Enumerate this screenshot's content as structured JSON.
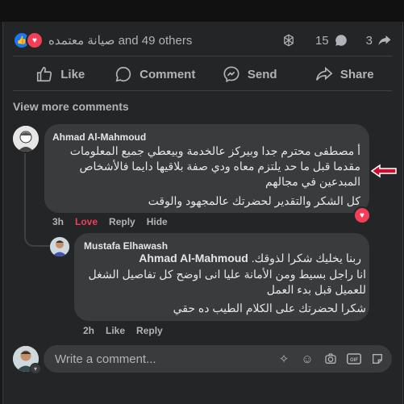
{
  "post": {
    "reaction_summary": "صيانة معتمده and 49 others",
    "comment_count": "15",
    "share_count": "3"
  },
  "actions": {
    "like": "Like",
    "comment": "Comment",
    "send": "Send",
    "share": "Share"
  },
  "view_more": "View more comments",
  "comments": [
    {
      "author": "Ahmad Al-Mahmoud",
      "paragraph1": "أ مصطفى محترم جدا وبيركز عالخدمة وبيعطي جميع المعلومات مقدما قبل ما حد يلتزم معاه ودي صفة بلاقيها دايما فالأشخاص المبدعين في مجالهم",
      "paragraph2": "كل الشكر والتقدير لحضرتك عالمجهود والوقت",
      "time": "3h",
      "love": "Love",
      "reply": "Reply",
      "hide": "Hide"
    },
    {
      "author": "Mustafa Elhawash",
      "mention": "Ahmad Al-Mahmoud",
      "line1": "ربنا يخليك شكرا لذوقك.",
      "paragraph2": "انا راجل بسيط ومن الأمانة عليا انى اوضح كل تفاصيل الشغل للعميل قبل بدء العمل",
      "paragraph3": "شكرا لحضرتك على الكلام الطيب ده حقي",
      "time": "2h",
      "like": "Like",
      "reply": "Reply"
    }
  ],
  "composer": {
    "placeholder": "Write a comment..."
  },
  "colors": {
    "background": "#242526",
    "bubble": "#3a3b3c",
    "love": "#f33e58",
    "like": "#1877f2",
    "arrow": "#c8102e"
  }
}
